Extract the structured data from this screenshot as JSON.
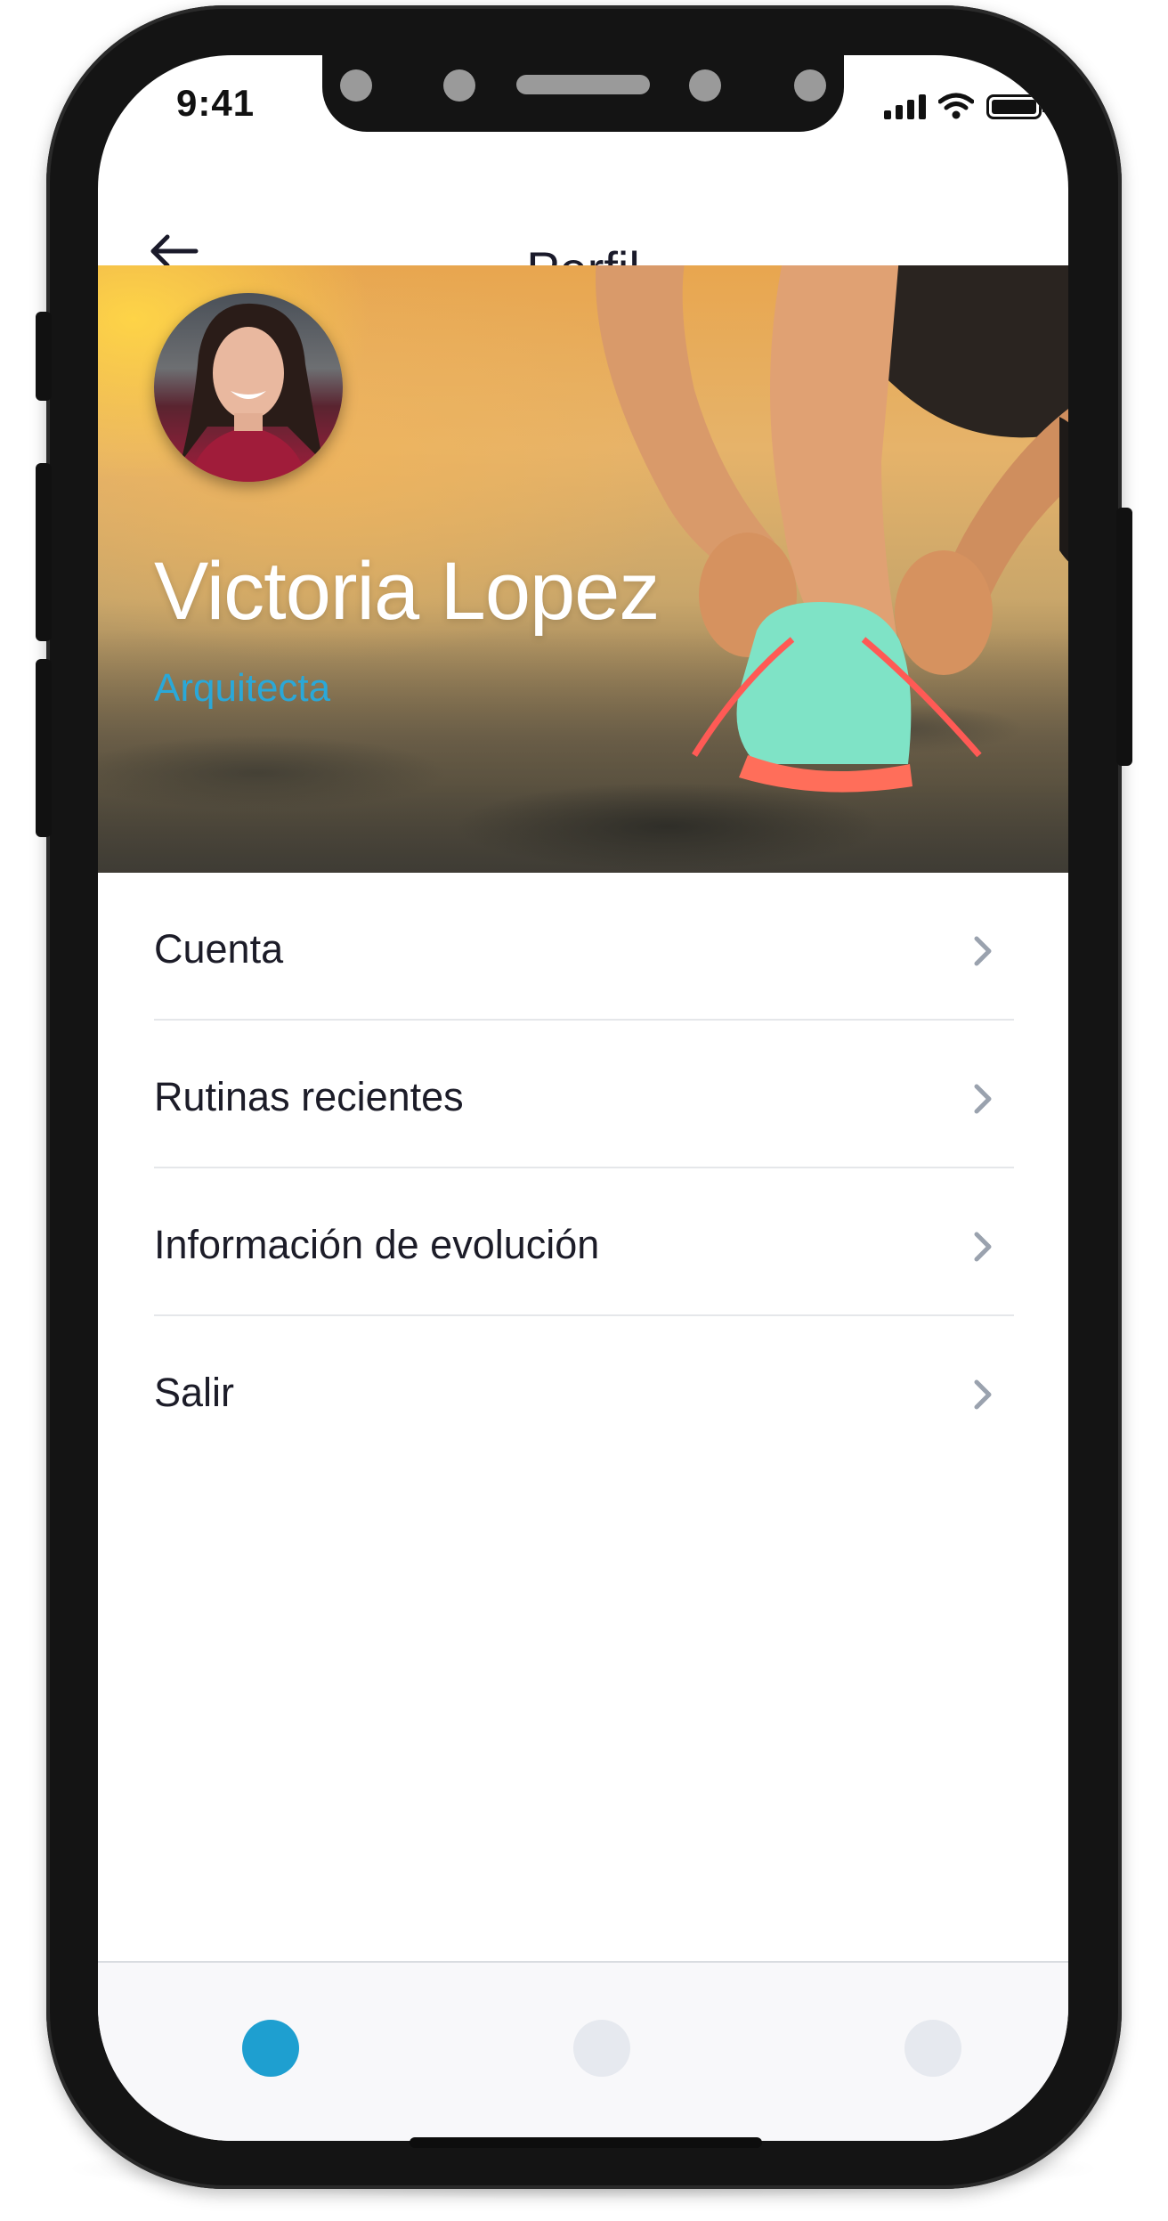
{
  "status_bar": {
    "time": "9:41"
  },
  "header": {
    "title": "Perfil",
    "back_icon": "arrow-left-icon"
  },
  "profile": {
    "name": "Victoria Lopez",
    "role": "Arquitecta"
  },
  "menu": {
    "items": [
      {
        "label": "Cuenta",
        "icon": "chevron-right-icon"
      },
      {
        "label": "Rutinas recientes",
        "icon": "chevron-right-icon"
      },
      {
        "label": "Información de evolución",
        "icon": "chevron-right-icon"
      },
      {
        "label": "Salir",
        "icon": "chevron-right-icon"
      }
    ]
  },
  "bottom_nav": {
    "items": [
      {
        "state": "active"
      },
      {
        "state": "inactive"
      },
      {
        "state": "inactive"
      }
    ]
  },
  "colors": {
    "accent": "#1e9fd0",
    "role_text": "#2aa8d8",
    "inactive_nav": "#e6e9ef",
    "frame": "#141414"
  }
}
